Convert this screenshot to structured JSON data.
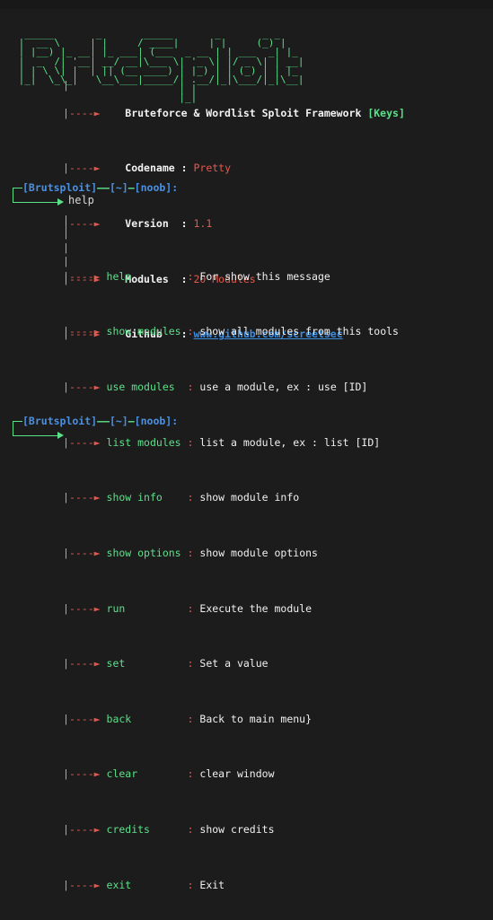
{
  "terminal": {
    "background": "#1c1c1c",
    "colors": {
      "green": "#5ce08a",
      "red": "#e05a4f",
      "blue": "#4a90e2",
      "white": "#f0f0f0",
      "link_blue": "#3c8ce0"
    }
  },
  "banner": {
    "art": "  _____       _       _____       _       _ _   \n |  __ \\     | |     / ____|     | |     (_) |  \n | |__) |_ __| |_ ___| (___  _ __ | | ___  _| |_ \n |  _  /| '__| __/ __|\\___ \\| '_ \\| |/ _ \\| | __|\n | | \\ \\| |  | || (__ ____) | |_) | | (_) | | |_ \n |_|  \\_\\_|   \\__\\___|_____/| .__/|_|\\___/|_|\\__|\n                            | |                  \n                            |_|                  "
  },
  "info": {
    "connector": "|----►",
    "rows": [
      {
        "label": "Bruteforce & Wordlist Sploit Framework",
        "separator": "",
        "value": "",
        "suffix": "[Keys]",
        "style": "title"
      },
      {
        "label": "Codename",
        "separator": ":",
        "value": "Pretty",
        "suffix": "",
        "style": "red"
      },
      {
        "label": "Version",
        "separator": ":",
        "value": "1.1",
        "suffix": "",
        "style": "red"
      },
      {
        "label": "Modules",
        "separator": ":",
        "value": "20 Modules",
        "suffix": "",
        "style": "red"
      },
      {
        "label": "Github",
        "separator": ":",
        "value": "www.github.com/screetsec",
        "suffix": "",
        "style": "url"
      }
    ]
  },
  "prompt_top": {
    "app": "[Brutsploit]",
    "dash1": "——",
    "path": "[~]",
    "dash2": "—",
    "user": "[noob]:",
    "command": "help"
  },
  "help": {
    "connector": "|----►",
    "separator": ":",
    "entries": [
      {
        "command": "help",
        "description": "For show this message"
      },
      {
        "command": "show modules",
        "description": "show all modules from this tools"
      },
      {
        "command": "use modules",
        "description": "use a module, ex : use [ID]"
      },
      {
        "command": "list modules",
        "description": "list a module, ex : list [ID]"
      },
      {
        "command": "show info",
        "description": "show module info"
      },
      {
        "command": "show options",
        "description": "show module options"
      },
      {
        "command": "run",
        "description": "Execute the module"
      },
      {
        "command": "set",
        "description": "Set a value"
      },
      {
        "command": "back",
        "description": "Back to main menu}"
      },
      {
        "command": "clear",
        "description": "clear window"
      },
      {
        "command": "credits",
        "description": "show credits"
      },
      {
        "command": "exit",
        "description": "Exit"
      }
    ]
  },
  "prompt_bottom": {
    "app": "[Brutsploit]",
    "dash1": "——",
    "path": "[~]",
    "dash2": "—",
    "user": "[noob]:",
    "command": ""
  }
}
